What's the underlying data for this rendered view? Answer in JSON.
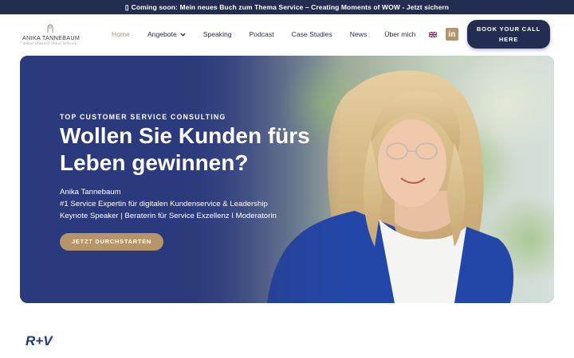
{
  "announcement": {
    "icon": "megaphone-icon",
    "text": "Coming soon: Mein neues Buch zum Thema Service – Creating Moments of WOW - Jetzt sichern"
  },
  "logo": {
    "name": "ANIKA TANNEBAUM",
    "tagline": "GREAT LEADERS GREAT SERVICE"
  },
  "nav": {
    "items": [
      {
        "label": "Home",
        "active": true
      },
      {
        "label": "Angebote",
        "dropdown": true
      },
      {
        "label": "Speaking"
      },
      {
        "label": "Podcast"
      },
      {
        "label": "Case Studies"
      },
      {
        "label": "News"
      },
      {
        "label": "Über mich"
      }
    ]
  },
  "header": {
    "language_icon": "uk-flag-icon",
    "linkedin_icon": "linkedin-icon",
    "linkedin_glyph": "in",
    "book_button": "BOOK YOUR CALL HERE"
  },
  "hero": {
    "eyebrow": "TOP CUSTOMER SERVICE CONSULTING",
    "headline": "Wollen Sie Kunden fürs Leben gewinnen?",
    "lines": [
      "Anika Tannebaum",
      "#1 Service Expertin für digitalen Kundenservice & Leadership",
      "Keynote Speaker | Beraterin für Service Exzellenz I Moderatorin"
    ],
    "cta": "JETZT DURCHSTARTEN"
  },
  "clients": {
    "first_logo": "R+V"
  },
  "colors": {
    "navy": "#232d52",
    "gold": "#b7956a",
    "hero_blue": "#2b3a7c",
    "white": "#ffffff"
  }
}
